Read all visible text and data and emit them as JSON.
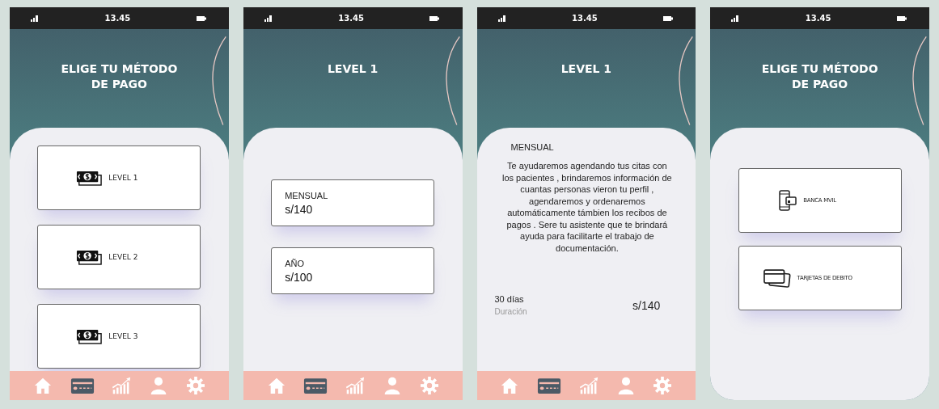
{
  "screens": [
    {
      "kind": "options",
      "status_bar": {
        "time": "13.45"
      },
      "title": "ELIGE TU MÉTODO\nDE PAGO",
      "options": [
        {
          "kind": "cash",
          "label": "LEVEL 1"
        },
        {
          "kind": "cash",
          "label": "LEVEL 2"
        },
        {
          "kind": "cash",
          "label": "LEVEL 3"
        }
      ],
      "nav": [
        {
          "kind": "home",
          "selected": false
        },
        {
          "kind": "card",
          "selected": true
        },
        {
          "kind": "chart",
          "selected": false
        },
        {
          "kind": "person",
          "selected": false
        },
        {
          "kind": "gear",
          "selected": false
        }
      ]
    },
    {
      "kind": "plans",
      "status_bar": {
        "time": "13.45"
      },
      "title": "LEVEL 1",
      "plans": [
        {
          "name": "MENSUAL",
          "price": "s/140"
        },
        {
          "name": "AÑO",
          "price": "s/100"
        }
      ],
      "nav": [
        {
          "kind": "home",
          "selected": false
        },
        {
          "kind": "card",
          "selected": true
        },
        {
          "kind": "chart",
          "selected": false
        },
        {
          "kind": "person",
          "selected": false
        },
        {
          "kind": "gear",
          "selected": false
        }
      ]
    },
    {
      "kind": "detail",
      "status_bar": {
        "time": "13.45"
      },
      "title": "LEVEL 1",
      "plan": "MENSUAL",
      "description": "Te ayudaremos agendando tus citas con los pacientes , brindaremos información de cuantas personas vieron tu perfil , agendaremos y ordenaremos automáticamente támbien los recibos de pagos . Sere tu asistente que te brindará ayuda para facilitarte el trabajo de documentación.",
      "duration": "30 días",
      "duration_label": "Duración",
      "price": "s/140",
      "nav": [
        {
          "kind": "home",
          "selected": false
        },
        {
          "kind": "card",
          "selected": true
        },
        {
          "kind": "chart",
          "selected": false
        },
        {
          "kind": "person",
          "selected": false
        },
        {
          "kind": "gear",
          "selected": false
        }
      ]
    },
    {
      "kind": "options",
      "status_bar": {
        "time": "13.45"
      },
      "title": "ELIGE TU MÉTODO\nDE PAGO",
      "options": [
        {
          "kind": "phone",
          "label": "BANCA MVIL"
        },
        {
          "kind": "cards",
          "label": "TARJETAS DE DEBITO"
        }
      ]
    }
  ]
}
